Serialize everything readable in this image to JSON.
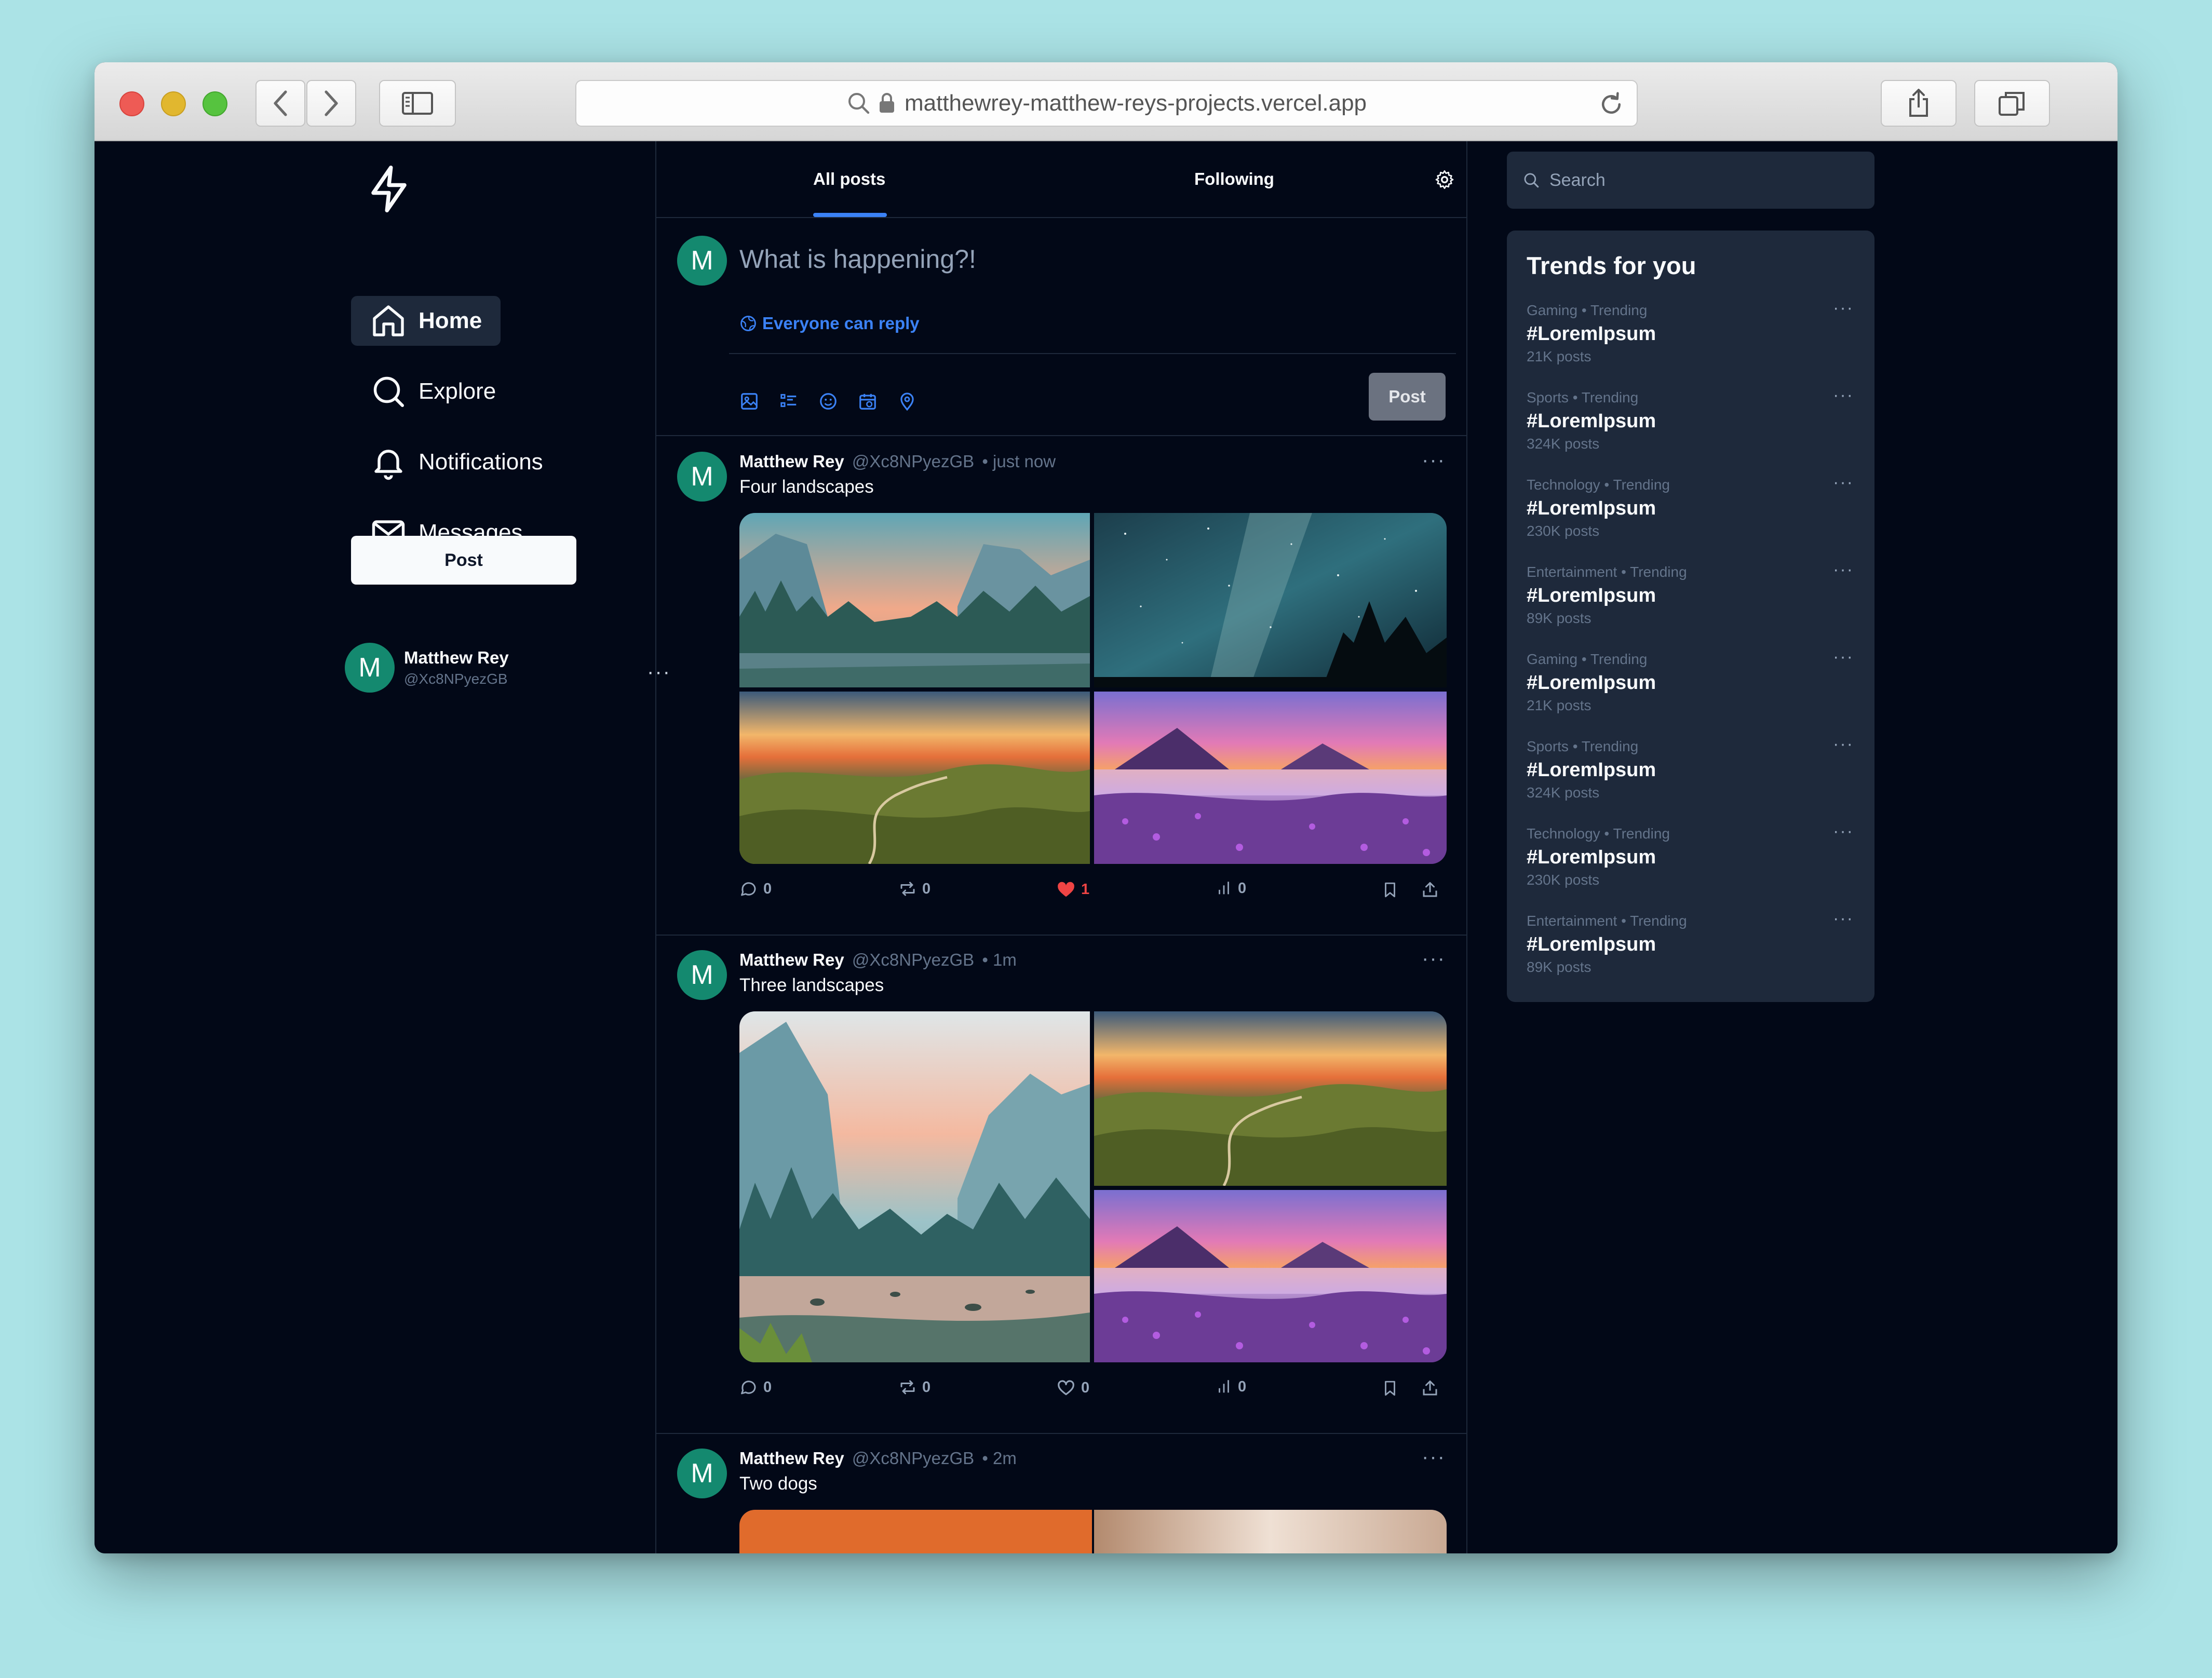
{
  "browser": {
    "url": "matthewrey-matthew-reys-projects.vercel.app"
  },
  "nav": {
    "items": [
      {
        "label": "Home",
        "icon": "home-icon"
      },
      {
        "label": "Explore",
        "icon": "search-icon"
      },
      {
        "label": "Notifications",
        "icon": "bell-icon"
      },
      {
        "label": "Messages",
        "icon": "mail-icon"
      }
    ],
    "post_label": "Post",
    "user": {
      "initial": "M",
      "name": "Matthew Rey",
      "handle": "@Xc8NPyezGB"
    },
    "user_more": "···"
  },
  "tabs": {
    "all": "All posts",
    "following": "Following"
  },
  "composer": {
    "initial": "M",
    "placeholder": "What is happening?!",
    "reply_setting": "Everyone can reply",
    "post_label": "Post"
  },
  "posts": [
    {
      "initial": "M",
      "name": "Matthew Rey",
      "handle": "@Xc8NPyezGB",
      "time": "• just now",
      "text": "Four landscapes",
      "more": "···",
      "stats": {
        "replies": "0",
        "reposts": "0",
        "likes": "1",
        "views": "0"
      },
      "liked": true
    },
    {
      "initial": "M",
      "name": "Matthew Rey",
      "handle": "@Xc8NPyezGB",
      "time": "• 1m",
      "text": "Three landscapes",
      "more": "···",
      "stats": {
        "replies": "0",
        "reposts": "0",
        "likes": "0",
        "views": "0"
      },
      "liked": false
    },
    {
      "initial": "M",
      "name": "Matthew Rey",
      "handle": "@Xc8NPyezGB",
      "time": "• 2m",
      "text": "Two dogs",
      "more": "···"
    }
  ],
  "search": {
    "placeholder": "Search"
  },
  "trends": {
    "title": "Trends for you",
    "more": "···",
    "items": [
      {
        "category": "Gaming • Trending",
        "tag": "#LoremIpsum",
        "count": "21K posts"
      },
      {
        "category": "Sports • Trending",
        "tag": "#LoremIpsum",
        "count": "324K posts"
      },
      {
        "category": "Technology • Trending",
        "tag": "#LoremIpsum",
        "count": "230K posts"
      },
      {
        "category": "Entertainment • Trending",
        "tag": "#LoremIpsum",
        "count": "89K posts"
      },
      {
        "category": "Gaming • Trending",
        "tag": "#LoremIpsum",
        "count": "21K posts"
      },
      {
        "category": "Sports • Trending",
        "tag": "#LoremIpsum",
        "count": "324K posts"
      },
      {
        "category": "Technology • Trending",
        "tag": "#LoremIpsum",
        "count": "230K posts"
      },
      {
        "category": "Entertainment • Trending",
        "tag": "#LoremIpsum",
        "count": "89K posts"
      }
    ]
  },
  "colors": {
    "background": "#020817",
    "panel": "#1e293b",
    "accent": "#3b82f6",
    "like": "#ef4444",
    "avatar": "#14896f"
  }
}
